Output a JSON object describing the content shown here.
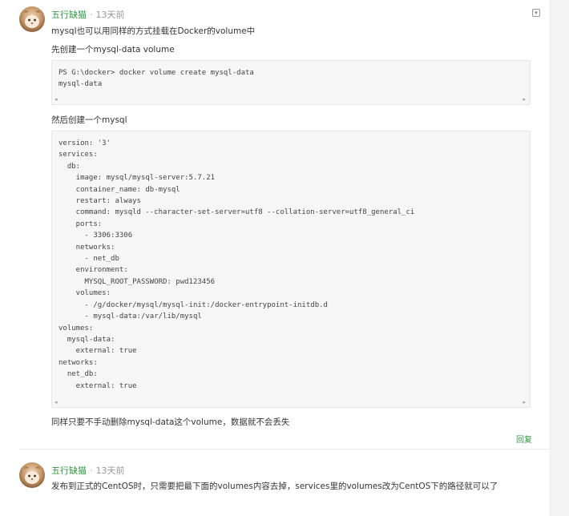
{
  "comments": [
    {
      "author": "五行缺猫",
      "separator": "·",
      "time": "13天前",
      "lines": {
        "intro": "mysql也可以用同样的方式挂载在Docker的volume中",
        "step1": "先创建一个mysql-data volume",
        "step2": "然后创建一个mysql",
        "outro": "同样只要不手动删除mysql-data这个volume，数据就不会丢失"
      },
      "code1": "PS G:\\docker> docker volume create mysql-data\nmysql-data",
      "code2": "version: '3'\nservices:\n  db:\n    image: mysql/mysql-server:5.7.21\n    container_name: db-mysql\n    restart: always\n    command: mysqld --character-set-server=utf8 --collation-server=utf8_general_ci\n    ports:\n      - 3306:3306\n    networks:\n      - net_db\n    environment:\n      MYSQL_ROOT_PASSWORD: pwd123456\n    volumes:\n      - /g/docker/mysql/mysql-init:/docker-entrypoint-initdb.d\n      - mysql-data:/var/lib/mysql\nvolumes:\n  mysql-data:\n    external: true\nnetworks:\n  net_db:\n    external: true",
      "reply_label": "回复",
      "collapse_icon": "▾"
    },
    {
      "author": "五行缺猫",
      "separator": "·",
      "time": "13天前",
      "text": "发布到正式的CentOS时，只需要把最下面的volumes内容去掉，services里的volumes改为CentOS下的路径就可以了"
    }
  ],
  "scroll_arrows": {
    "left": "◂",
    "right": "▸"
  },
  "colors": {
    "author": "#2f9b3f",
    "code_bg": "#f6f6f6"
  }
}
